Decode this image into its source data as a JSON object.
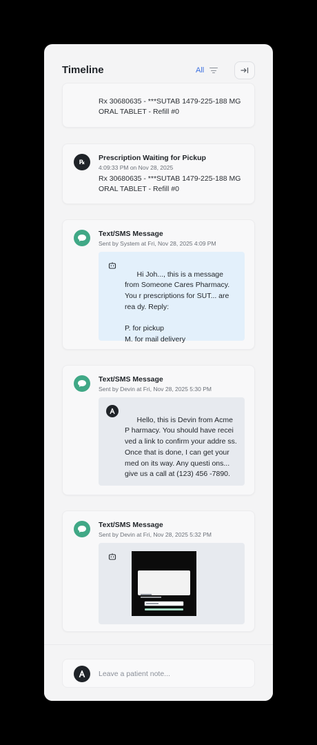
{
  "header": {
    "title": "Timeline",
    "filter_label": "All"
  },
  "events": [
    {
      "type": "prescription",
      "body": "Rx 30680635 - ***SUTAB 1479-225-188 MG ORAL TABLET - Refill #0"
    },
    {
      "type": "prescription",
      "icon_text": "℞",
      "title": "Prescription Waiting for Pickup",
      "subtitle": "4:09:33 PM on Nov 28, 2025",
      "body": "Rx 30680635 - ***SUTAB 1479-225-188 MG ORAL TABLET - Refill #0"
    },
    {
      "type": "sms",
      "title": "Text/SMS Message",
      "subtitle": "Sent by System at Fri, Nov 28, 2025 4:09 PM",
      "sender": "bot",
      "message": "Hi Joh..., this is a message from Someone Cares Pharmacy. You r prescriptions for SUT... are rea dy. Reply:\n\nP. for pickup\nM. for mail delivery"
    },
    {
      "type": "sms",
      "title": "Text/SMS Message",
      "subtitle": "Sent by Devin at Fri, Nov 28, 2025 5:30 PM",
      "sender": "agent",
      "message": "Hello, this is Devin from Acme P harmacy. You should have recei ved a link to confirm your addre ss. Once that is done, I can get your med on its way. Any questi ons... give us a call at (123) 456 -7890."
    },
    {
      "type": "sms",
      "title": "Text/SMS Message",
      "subtitle": "Sent by Devin at Fri, Nov 28, 2025 5:32 PM",
      "sender": "bot",
      "attachment": "screenshot"
    }
  ],
  "composer": {
    "placeholder": "Leave a patient note..."
  },
  "colors": {
    "accent": "#3b6fe0",
    "sms_icon": "#40a886",
    "bubble_system": "#e3f0fb",
    "bubble_agent": "#e7eaef"
  }
}
